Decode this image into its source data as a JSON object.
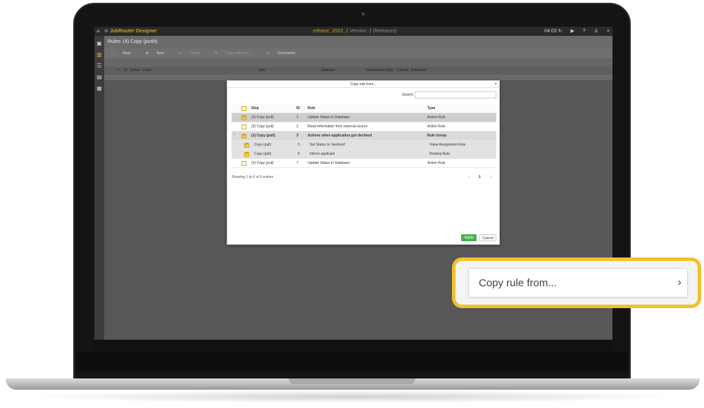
{
  "app": {
    "logo": "JobRouter Designer",
    "release": "release_2023_1",
    "version": "Version: 1 (Releases)",
    "time": "04:03"
  },
  "page": {
    "title": "Rules: (4) Copy (push)"
  },
  "toolbar": {
    "back": "Back",
    "new": "New",
    "delete": "Delete",
    "copy": "Copy rule from...",
    "comments": "Comments"
  },
  "grid": {
    "columns": [
      "ID",
      "Active",
      "Label",
      "Type",
      "Subtable",
      "Subsequent Step",
      "Cancel",
      "Execution"
    ]
  },
  "dialog": {
    "title": "Copy rule from...",
    "search_label": "Search",
    "search_value": "",
    "columns": {
      "step": "Step",
      "id": "ID",
      "rule": "Rule",
      "type": "Type"
    },
    "rows": [
      {
        "step": "(3) Copy (pull)",
        "id": "1",
        "rule": "Update Status in Database",
        "type": "Action Rule"
      },
      {
        "step": "(3) Copy (pull)",
        "id": "2",
        "rule": "Read information from external source",
        "type": "Action Rule"
      },
      {
        "step": "(3) Copy (pull)",
        "id": "3",
        "rule": "Actions when application got declined",
        "type": "Rule Group"
      },
      {
        "step": "Copy (pull)",
        "id": "5",
        "rule": "Set Status to 'declined'",
        "type": "Value Assignment Rule"
      },
      {
        "step": "Copy (pull)",
        "id": "6",
        "rule": "Inform applicant",
        "type": "Routing Rule"
      },
      {
        "step": "(3) Copy (pull)",
        "id": "7",
        "rule": "Update Status in Database",
        "type": "Action Rule"
      }
    ],
    "info": "Showing 1 to 6 of 6 entries",
    "page_current": "1",
    "apply": "Apply",
    "cancel": "Cancel"
  },
  "callout": {
    "label": "Copy rule from..."
  },
  "colors": {
    "accent": "#f2c12e",
    "apply_green": "#4caf50",
    "title_gold": "#c9a227"
  }
}
